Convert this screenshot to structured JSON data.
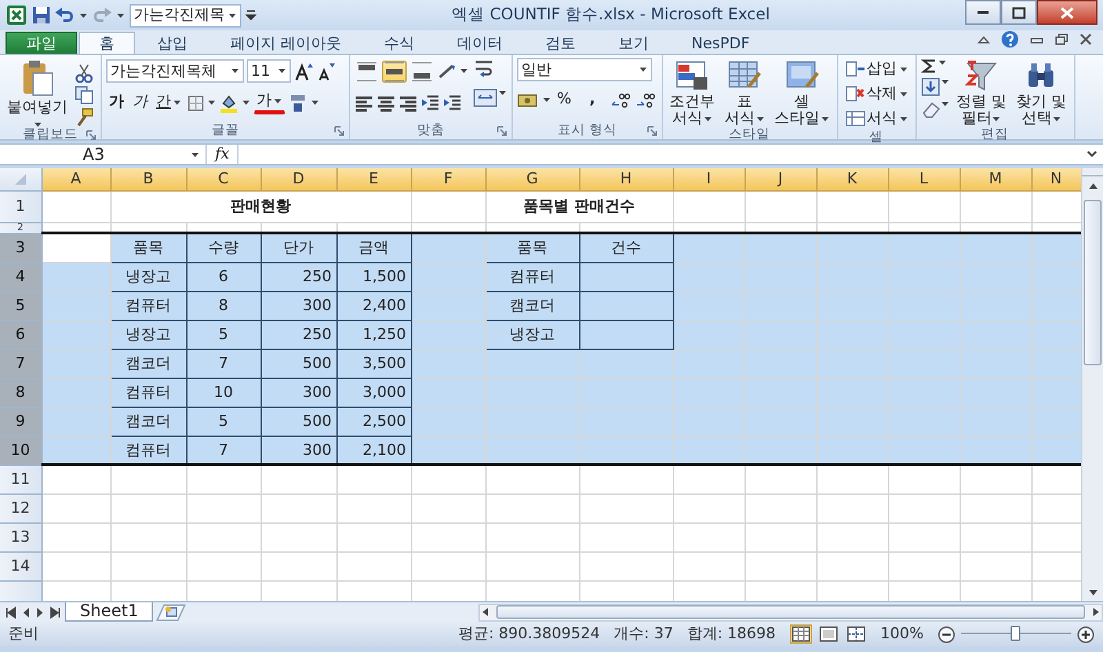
{
  "window": {
    "title": "엑셀 COUNTIF 함수.xlsx - Microsoft Excel"
  },
  "quick_access": {
    "font_box": "가는각진제목"
  },
  "ribbon_tabs": [
    {
      "label": "파일",
      "kind": "file",
      "selected": false
    },
    {
      "label": "홈",
      "kind": "tab",
      "selected": true
    },
    {
      "label": "삽입",
      "kind": "tab",
      "selected": false
    },
    {
      "label": "페이지 레이아웃",
      "kind": "tab",
      "selected": false
    },
    {
      "label": "수식",
      "kind": "tab",
      "selected": false
    },
    {
      "label": "데이터",
      "kind": "tab",
      "selected": false
    },
    {
      "label": "검토",
      "kind": "tab",
      "selected": false
    },
    {
      "label": "보기",
      "kind": "tab",
      "selected": false
    },
    {
      "label": "NesPDF",
      "kind": "tab",
      "selected": false
    }
  ],
  "ribbon_groups": [
    {
      "kind": "clipboard",
      "label": "클립보드",
      "paste": "붙여넣기"
    },
    {
      "kind": "font",
      "label": "글꼴",
      "font_name": "가는각진제목체",
      "font_size": "11",
      "bold": "가",
      "italic": "가",
      "underline": "간",
      "font_color": "가"
    },
    {
      "kind": "alignment",
      "label": "맞춤",
      "vertical_buttons": [
        {
          "kind": "top",
          "selected": false
        },
        {
          "kind": "middle",
          "selected": true
        },
        {
          "kind": "bottom",
          "selected": false
        }
      ]
    },
    {
      "kind": "number",
      "label": "표시 형식",
      "format": "일반",
      "percent": "%",
      "comma": ","
    },
    {
      "kind": "styles",
      "label": "스타일",
      "buttons": [
        {
          "lines": [
            "조건부",
            "서식"
          ]
        },
        {
          "lines": [
            "표",
            "서식"
          ]
        },
        {
          "lines": [
            "셀",
            "스타일"
          ]
        }
      ]
    },
    {
      "kind": "cells",
      "label": "셀",
      "buttons": [
        "삽입",
        "삭제",
        "서식"
      ]
    },
    {
      "kind": "editing",
      "label": "편집",
      "buttons": [
        {
          "lines": [
            "정렬 및",
            "필터"
          ]
        },
        {
          "lines": [
            "찾기 및",
            "선택"
          ]
        }
      ]
    }
  ],
  "formula_bar": {
    "name_box": "A3",
    "fx": "fx"
  },
  "sheet": {
    "columns": [
      {
        "label": "A",
        "highlighted": true
      },
      {
        "label": "B",
        "highlighted": true
      },
      {
        "label": "C",
        "highlighted": true
      },
      {
        "label": "D",
        "highlighted": true
      },
      {
        "label": "E",
        "highlighted": true
      },
      {
        "label": "F",
        "highlighted": true
      },
      {
        "label": "G",
        "highlighted": true
      },
      {
        "label": "H",
        "highlighted": true
      },
      {
        "label": "I",
        "highlighted": true
      },
      {
        "label": "J",
        "highlighted": true
      },
      {
        "label": "K",
        "highlighted": true
      },
      {
        "label": "L",
        "highlighted": true
      },
      {
        "label": "M",
        "highlighted": true
      },
      {
        "label": "N",
        "highlighted": true
      }
    ],
    "rows": [
      {
        "header": "1",
        "selected": false,
        "cells": [
          {
            "kind": "empty"
          },
          {
            "kind": "title",
            "text": "판매현황",
            "colspan": 4
          },
          {
            "kind": "empty"
          },
          {
            "kind": "title",
            "text": "품목별 판매건수",
            "colspan": 2
          }
        ]
      },
      {
        "header": "2",
        "selected": false,
        "cells": []
      },
      {
        "header": "3",
        "selected": true,
        "cells": [
          {
            "kind": "active"
          },
          {
            "kind": "head",
            "text": "품목"
          },
          {
            "kind": "head",
            "text": "수량"
          },
          {
            "kind": "head",
            "text": "단가"
          },
          {
            "kind": "head",
            "text": "금액"
          },
          {
            "kind": "empty"
          },
          {
            "kind": "head",
            "text": "품목"
          },
          {
            "kind": "head",
            "text": "건수"
          }
        ]
      },
      {
        "header": "4",
        "selected": true,
        "cells": [
          {
            "kind": "empty"
          },
          {
            "kind": "item",
            "text": "냉장고"
          },
          {
            "kind": "count",
            "text": "6"
          },
          {
            "kind": "amount",
            "text": "250"
          },
          {
            "kind": "amount",
            "text": "1,500"
          },
          {
            "kind": "empty"
          },
          {
            "kind": "item",
            "text": "컴퓨터"
          },
          {
            "kind": "blank"
          }
        ]
      },
      {
        "header": "5",
        "selected": true,
        "cells": [
          {
            "kind": "empty"
          },
          {
            "kind": "item",
            "text": "컴퓨터"
          },
          {
            "kind": "count",
            "text": "8"
          },
          {
            "kind": "amount",
            "text": "300"
          },
          {
            "kind": "amount",
            "text": "2,400"
          },
          {
            "kind": "empty"
          },
          {
            "kind": "item",
            "text": "캠코더"
          },
          {
            "kind": "blank"
          }
        ]
      },
      {
        "header": "6",
        "selected": true,
        "cells": [
          {
            "kind": "empty"
          },
          {
            "kind": "item",
            "text": "냉장고"
          },
          {
            "kind": "count",
            "text": "5"
          },
          {
            "kind": "amount",
            "text": "250"
          },
          {
            "kind": "amount",
            "text": "1,250"
          },
          {
            "kind": "empty"
          },
          {
            "kind": "item",
            "text": "냉장고"
          },
          {
            "kind": "blank"
          }
        ]
      },
      {
        "header": "7",
        "selected": true,
        "cells": [
          {
            "kind": "empty"
          },
          {
            "kind": "item",
            "text": "캠코더"
          },
          {
            "kind": "count",
            "text": "7"
          },
          {
            "kind": "amount",
            "text": "500"
          },
          {
            "kind": "amount",
            "text": "3,500"
          }
        ]
      },
      {
        "header": "8",
        "selected": true,
        "cells": [
          {
            "kind": "empty"
          },
          {
            "kind": "item",
            "text": "컴퓨터"
          },
          {
            "kind": "count",
            "text": "10"
          },
          {
            "kind": "amount",
            "text": "300"
          },
          {
            "kind": "amount",
            "text": "3,000"
          }
        ]
      },
      {
        "header": "9",
        "selected": true,
        "cells": [
          {
            "kind": "empty"
          },
          {
            "kind": "item",
            "text": "캠코더"
          },
          {
            "kind": "count",
            "text": "5"
          },
          {
            "kind": "amount",
            "text": "500"
          },
          {
            "kind": "amount",
            "text": "2,500"
          }
        ]
      },
      {
        "header": "10",
        "selected": true,
        "cells": [
          {
            "kind": "empty"
          },
          {
            "kind": "item",
            "text": "컴퓨터"
          },
          {
            "kind": "count",
            "text": "7"
          },
          {
            "kind": "amount",
            "text": "300"
          },
          {
            "kind": "amount",
            "text": "2,100"
          }
        ]
      },
      {
        "header": "11",
        "selected": false,
        "cells": []
      },
      {
        "header": "12",
        "selected": false,
        "cells": []
      },
      {
        "header": "13",
        "selected": false,
        "cells": []
      },
      {
        "header": "14",
        "selected": false,
        "cells": []
      }
    ]
  },
  "sheet_tabs": [
    {
      "label": "Sheet1",
      "selected": true
    }
  ],
  "status_bar": {
    "ready": "준비",
    "stats": [
      "평균: 890.3809524",
      "개수: 37",
      "합계: 18698"
    ],
    "views": [
      {
        "kind": "normal",
        "selected": true
      },
      {
        "kind": "page-layout",
        "selected": false
      },
      {
        "kind": "page-break",
        "selected": false
      }
    ],
    "zoom": "100%",
    "zoom_slider": {
      "level": 0.5
    }
  }
}
